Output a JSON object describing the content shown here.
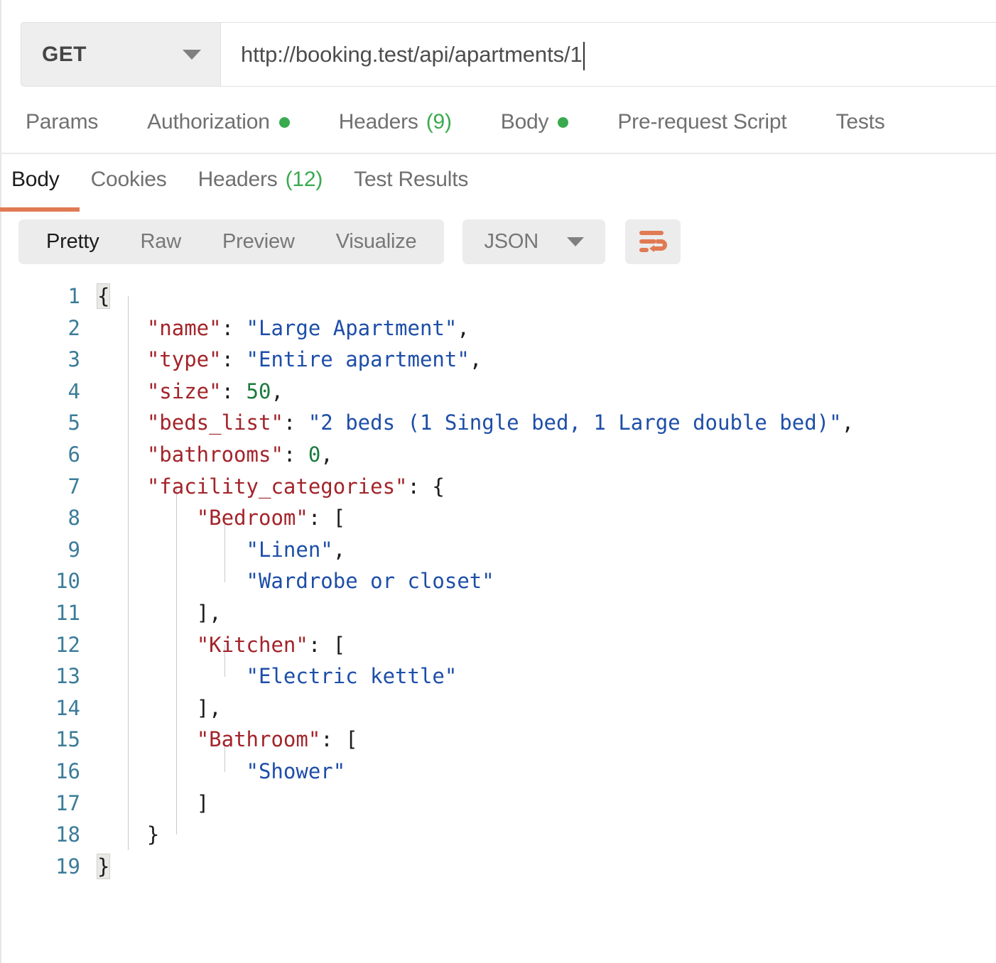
{
  "request": {
    "method": "GET",
    "method_caret_icon": "chevron-down-icon",
    "url": "http://booking.test/api/apartments/1",
    "url_placeholder": "Enter request URL",
    "tabs": [
      {
        "label": "Params",
        "indicator": "",
        "count": ""
      },
      {
        "label": "Authorization",
        "indicator": "dot",
        "count": ""
      },
      {
        "label": "Headers",
        "indicator": "",
        "count": "(9)"
      },
      {
        "label": "Body",
        "indicator": "dot",
        "count": ""
      },
      {
        "label": "Pre-request Script",
        "indicator": "",
        "count": ""
      },
      {
        "label": "Tests",
        "indicator": "",
        "count": ""
      }
    ]
  },
  "response": {
    "tabs": [
      {
        "label": "Body",
        "count": "",
        "active": true
      },
      {
        "label": "Cookies",
        "count": "",
        "active": false
      },
      {
        "label": "Headers",
        "count": "(12)",
        "active": false
      },
      {
        "label": "Test Results",
        "count": "",
        "active": false
      }
    ],
    "format_modes": [
      {
        "label": "Pretty",
        "active": true
      },
      {
        "label": "Raw",
        "active": false
      },
      {
        "label": "Preview",
        "active": false
      },
      {
        "label": "Visualize",
        "active": false
      }
    ],
    "language": "JSON",
    "language_caret_icon": "chevron-down-icon",
    "wrap_icon": "text-wrap-icon"
  },
  "colors": {
    "accent_orange": "#e07a52",
    "status_green": "#3aaa4f",
    "json_key": "#a3242a",
    "json_string": "#1d4ea8",
    "json_number": "#1b7a3e",
    "line_number": "#3b7c99"
  },
  "body": {
    "line_numbers": [
      "1",
      "2",
      "3",
      "4",
      "5",
      "6",
      "7",
      "8",
      "9",
      "10",
      "11",
      "12",
      "13",
      "14",
      "15",
      "16",
      "17",
      "18",
      "19"
    ],
    "lines": [
      "{",
      "    \"name\": \"Large Apartment\",",
      "    \"type\": \"Entire apartment\",",
      "    \"size\": 50,",
      "    \"beds_list\": \"2 beds (1 Single bed, 1 Large double bed)\",",
      "    \"bathrooms\": 0,",
      "    \"facility_categories\": {",
      "        \"Bedroom\": [",
      "            \"Linen\",",
      "            \"Wardrobe or closet\"",
      "        ],",
      "        \"Kitchen\": [",
      "            \"Electric kettle\"",
      "        ],",
      "        \"Bathroom\": [",
      "            \"Shower\"",
      "        ]",
      "    }",
      "}"
    ],
    "json": {
      "name": "Large Apartment",
      "type": "Entire apartment",
      "size": 50,
      "beds_list": "2 beds (1 Single bed, 1 Large double bed)",
      "bathrooms": 0,
      "facility_categories": {
        "Bedroom": [
          "Linen",
          "Wardrobe or closet"
        ],
        "Kitchen": [
          "Electric kettle"
        ],
        "Bathroom": [
          "Shower"
        ]
      }
    }
  }
}
